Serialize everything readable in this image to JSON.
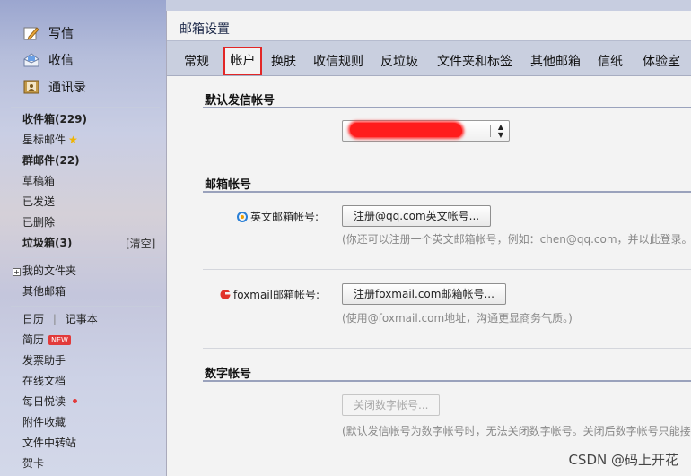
{
  "sidebar": {
    "compose": "写信",
    "receive": "收信",
    "contacts": "通讯录",
    "inbox": "收件箱(229)",
    "starred": "星标邮件",
    "group": "群邮件(22)",
    "drafts": "草稿箱",
    "sent": "已发送",
    "deleted": "已删除",
    "spam": "垃圾箱(3)",
    "clear": "[清空]",
    "my_folders": "我的文件夹",
    "other_mail": "其他邮箱",
    "calendar": "日历",
    "separator": "|",
    "notes": "记事本",
    "resume": "简历",
    "new_badge": "NEW",
    "invoice": "发票助手",
    "online_docs": "在线文档",
    "daily_reading": "每日悦读",
    "attachments": "附件收藏",
    "file_transfer": "文件中转站",
    "cards": "贺卡"
  },
  "header": {
    "title": "邮箱设置"
  },
  "tabs": [
    "常规",
    "帐户",
    "换肤",
    "收信规则",
    "反垃圾",
    "文件夹和标签",
    "其他邮箱",
    "信纸",
    "体验室"
  ],
  "active_tab": "帐户",
  "sections": {
    "default_sender": {
      "title": "默认发信帐号"
    },
    "mail_accounts": {
      "title": "邮箱帐号",
      "english_label": "英文邮箱帐号:",
      "english_button": "注册@qq.com英文帐号...",
      "english_hint": "(你还可以注册一个英文邮箱帐号，例如：chen@qq.com，并以此登录。",
      "foxmail_label": "foxmail邮箱帐号:",
      "foxmail_button": "注册foxmail.com邮箱帐号...",
      "foxmail_hint": "(使用@foxmail.com地址，沟通更显商务气质。)"
    },
    "digital_account": {
      "title": "数字帐号",
      "close_button": "关闭数字帐号...",
      "hint": "(默认发信帐号为数字帐号时，无法关闭数字帐号。关闭后数字帐号只能接"
    }
  },
  "watermark": "CSDN @码上开花",
  "colors": {
    "active_tab_border": "#e22626",
    "redaction": "#ff1c1c",
    "badge": "#e23a3a"
  }
}
